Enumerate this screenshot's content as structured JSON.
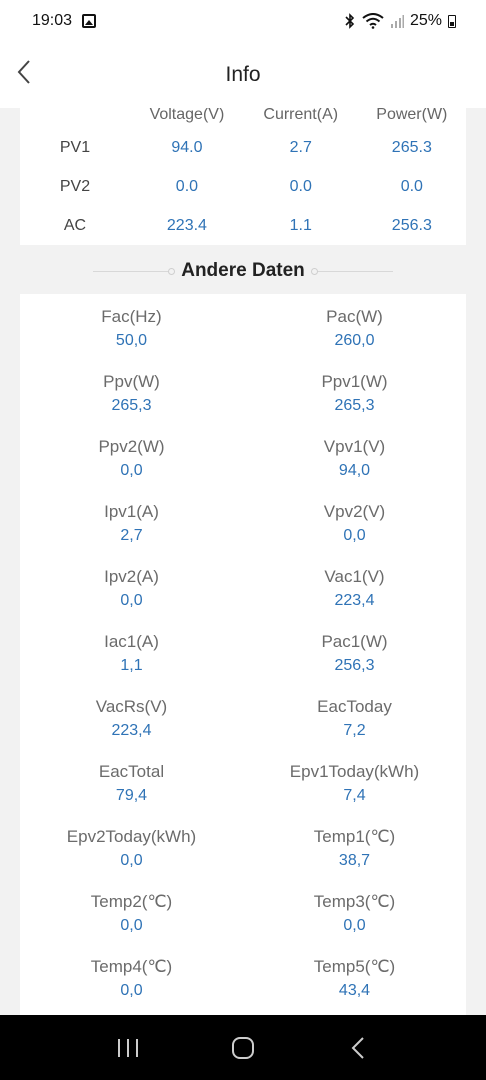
{
  "status_bar": {
    "time": "19:03",
    "battery": "25%"
  },
  "app_bar": {
    "title": "Info"
  },
  "pv_table": {
    "headers": [
      "Voltage(V)",
      "Current(A)",
      "Power(W)"
    ],
    "rows": [
      {
        "label": "PV1",
        "values": [
          "94.0",
          "2.7",
          "265.3"
        ]
      },
      {
        "label": "PV2",
        "values": [
          "0.0",
          "0.0",
          "0.0"
        ]
      },
      {
        "label": "AC",
        "values": [
          "223.4",
          "1.1",
          "256.3"
        ]
      }
    ]
  },
  "section": {
    "title": "Andere Daten"
  },
  "other_data": [
    {
      "label": "Fac(Hz)",
      "value": "50,0"
    },
    {
      "label": "Pac(W)",
      "value": "260,0"
    },
    {
      "label": "Ppv(W)",
      "value": "265,3"
    },
    {
      "label": "Ppv1(W)",
      "value": "265,3"
    },
    {
      "label": "Ppv2(W)",
      "value": "0,0"
    },
    {
      "label": "Vpv1(V)",
      "value": "94,0"
    },
    {
      "label": "Ipv1(A)",
      "value": "2,7"
    },
    {
      "label": "Vpv2(V)",
      "value": "0,0"
    },
    {
      "label": "Ipv2(A)",
      "value": "0,0"
    },
    {
      "label": "Vac1(V)",
      "value": "223,4"
    },
    {
      "label": "Iac1(A)",
      "value": "1,1"
    },
    {
      "label": "Pac1(W)",
      "value": "256,3"
    },
    {
      "label": "VacRs(V)",
      "value": "223,4"
    },
    {
      "label": "EacToday",
      "value": "7,2"
    },
    {
      "label": "EacTotal",
      "value": "79,4"
    },
    {
      "label": "Epv1Today(kWh)",
      "value": "7,4"
    },
    {
      "label": "Epv2Today(kWh)",
      "value": "0,0"
    },
    {
      "label": "Temp1(℃)",
      "value": "38,7"
    },
    {
      "label": "Temp2(℃)",
      "value": "0,0"
    },
    {
      "label": "Temp3(℃)",
      "value": "0,0"
    },
    {
      "label": "Temp4(℃)",
      "value": "0,0"
    },
    {
      "label": "Temp5(℃)",
      "value": "43,4"
    }
  ],
  "colors": {
    "value_blue": "#2f73b6",
    "label_gray": "#6b6b6b"
  }
}
